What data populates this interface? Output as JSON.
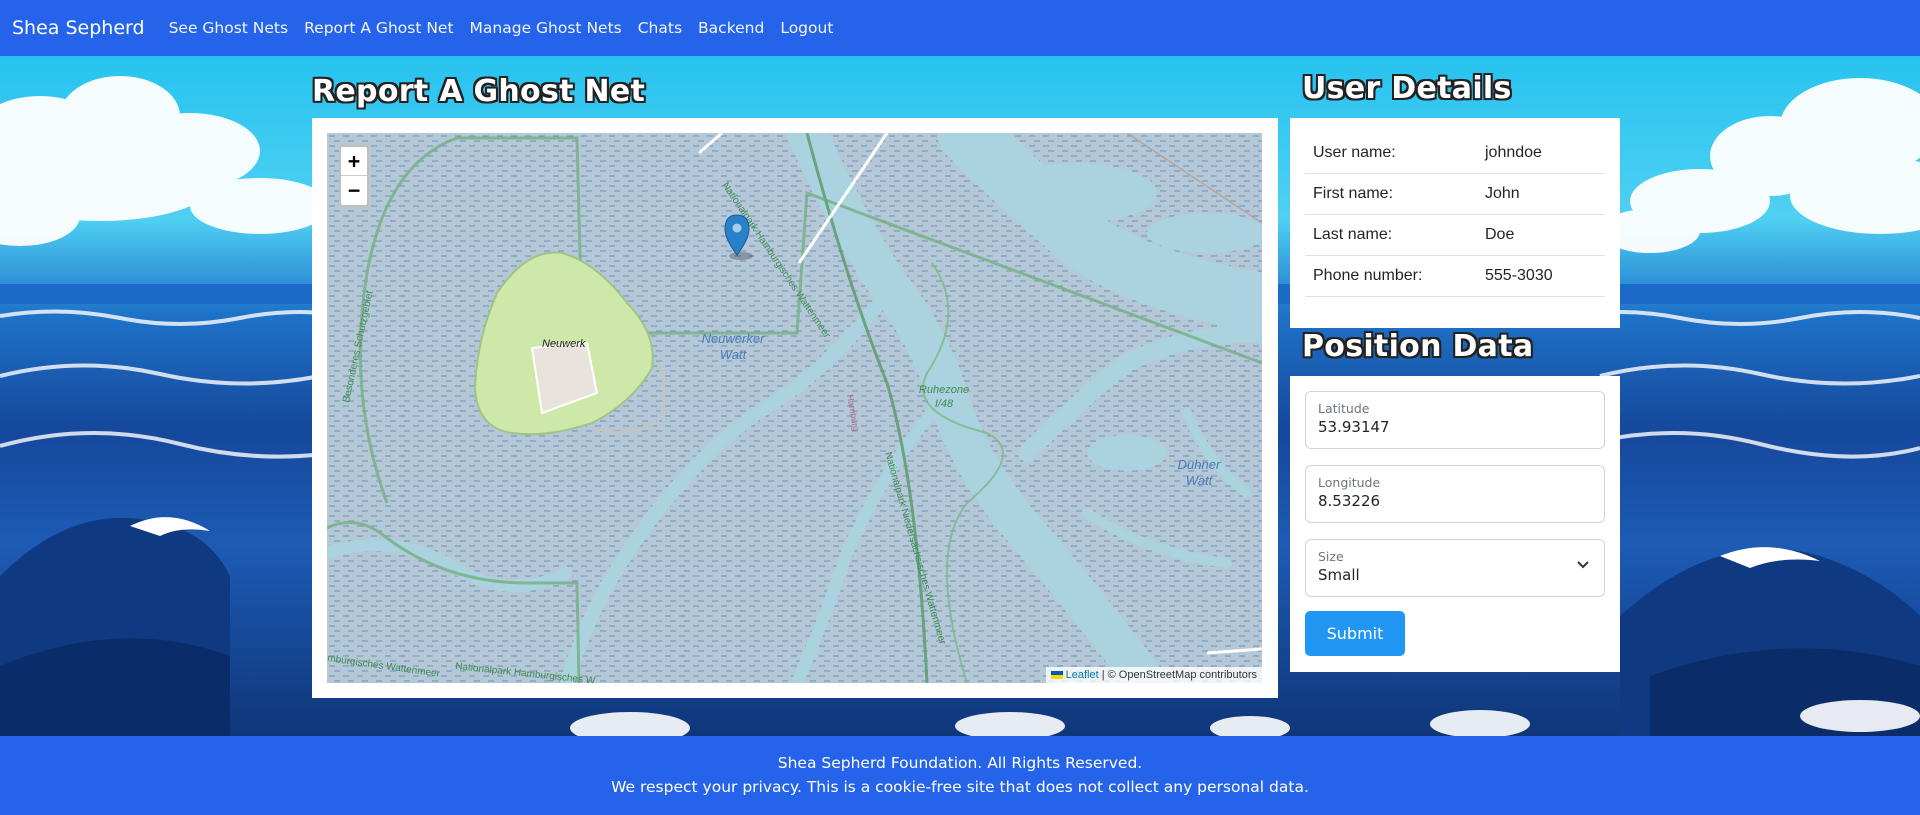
{
  "nav": {
    "brand": "Shea Sepherd",
    "links": [
      "See Ghost Nets",
      "Report A Ghost Net",
      "Manage Ghost Nets",
      "Chats",
      "Backend",
      "Logout"
    ]
  },
  "report": {
    "title": "Report A Ghost Net",
    "map": {
      "zoom_in": "+",
      "zoom_out": "−",
      "attribution_leaflet": "Leaflet",
      "attribution_rest": " | © OpenStreetMap contributors",
      "labels": {
        "island": "Neuwerk",
        "watt1_a": "Neuwerker",
        "watt1_b": "Watt",
        "ruhezone_a": "Ruhezone",
        "ruhezone_b": "I/48",
        "duhner_a": "Duhner",
        "duhner_b": "Watt",
        "np_hamburg": "Nationalpark Hamburgisches Wattenmeer",
        "np_nds": "Nationalpark Niedersächsisches Wattenmeer",
        "hamburg": "Hamburg",
        "schutzgebiet": "Besonderes Schutzgebiet",
        "bottom1": "mburgisches Wattenmeer",
        "bottom2": "Nationalpark Hamburgisches W"
      }
    }
  },
  "user": {
    "title": "User Details",
    "rows": [
      {
        "label": "User name:",
        "value": "johndoe"
      },
      {
        "label": "First name:",
        "value": "John"
      },
      {
        "label": "Last name:",
        "value": "Doe"
      },
      {
        "label": "Phone number:",
        "value": "555-3030"
      }
    ]
  },
  "position": {
    "title": "Position Data",
    "latitude_label": "Latitude",
    "latitude_value": "53.93147",
    "longitude_label": "Longitude",
    "longitude_value": "8.53226",
    "size_label": "Size",
    "size_value": "Small",
    "submit_label": "Submit"
  },
  "footer": {
    "line1": "Shea Sepherd Foundation. All Rights Reserved.",
    "line2": "We respect your privacy. This is a cookie-free site that does not collect any personal data."
  },
  "colors": {
    "navbar": "#2563eb",
    "submit": "#2196f3",
    "map_water": "#aad3df",
    "island": "#cde8a8"
  }
}
